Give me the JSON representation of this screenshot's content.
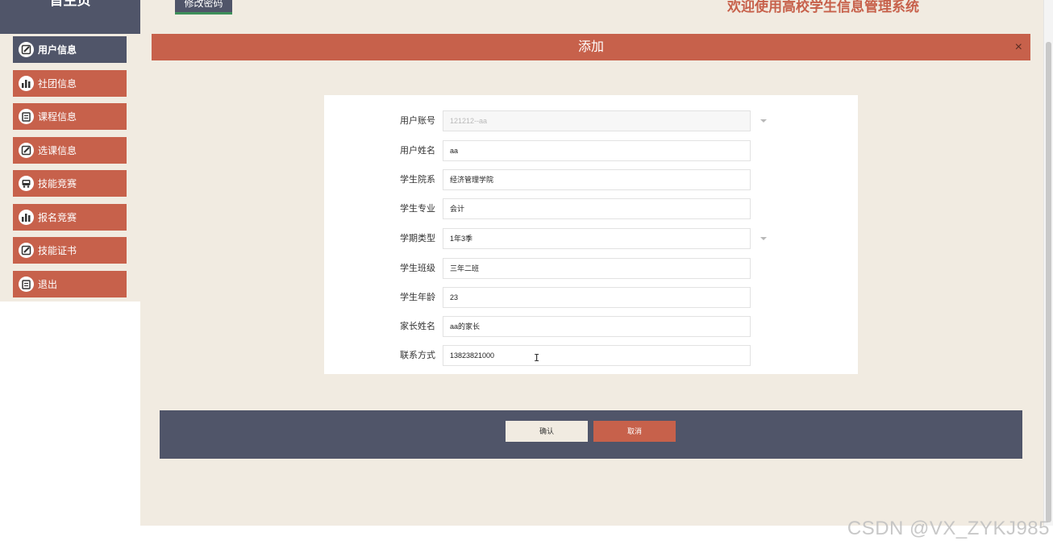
{
  "header": {
    "home_label": "首主页",
    "change_password_label": "修改密码",
    "welcome_text": "欢迎使用高校学生信息管理系统"
  },
  "sidebar": {
    "items": [
      {
        "label": "用户信息",
        "icon": "edit-icon",
        "active": true
      },
      {
        "label": "社团信息",
        "icon": "bar-chart-icon",
        "active": false
      },
      {
        "label": "课程信息",
        "icon": "clipboard-icon",
        "active": false
      },
      {
        "label": "选课信息",
        "icon": "edit-icon",
        "active": false
      },
      {
        "label": "技能竞赛",
        "icon": "bus-icon",
        "active": false
      },
      {
        "label": "报名竞赛",
        "icon": "bar-chart-icon",
        "active": false
      },
      {
        "label": "技能证书",
        "icon": "edit-icon",
        "active": false
      },
      {
        "label": "退出",
        "icon": "clipboard-icon",
        "active": false
      }
    ]
  },
  "dialog": {
    "title": "添加",
    "close_label": "×",
    "fields": [
      {
        "label": "用户账号",
        "value": "121212--aa",
        "type": "select",
        "disabled": true
      },
      {
        "label": "用户姓名",
        "value": "aa",
        "type": "text"
      },
      {
        "label": "学生院系",
        "value": "经济管理学院",
        "type": "text"
      },
      {
        "label": "学生专业",
        "value": "会计",
        "type": "text"
      },
      {
        "label": "学期类型",
        "value": "1年3季",
        "type": "select"
      },
      {
        "label": "学生班级",
        "value": "三年二班",
        "type": "text"
      },
      {
        "label": "学生年龄",
        "value": "23",
        "type": "text"
      },
      {
        "label": "家长姓名",
        "value": "aa的家长",
        "type": "text"
      },
      {
        "label": "联系方式",
        "value": "13823821000",
        "type": "text"
      }
    ],
    "confirm_label": "确认",
    "cancel_label": "取消"
  },
  "watermark": "CSDN @VX_ZYKJ985",
  "colors": {
    "primary": "#c7614b",
    "dark": "#505569",
    "background": "#f1ebe1"
  }
}
